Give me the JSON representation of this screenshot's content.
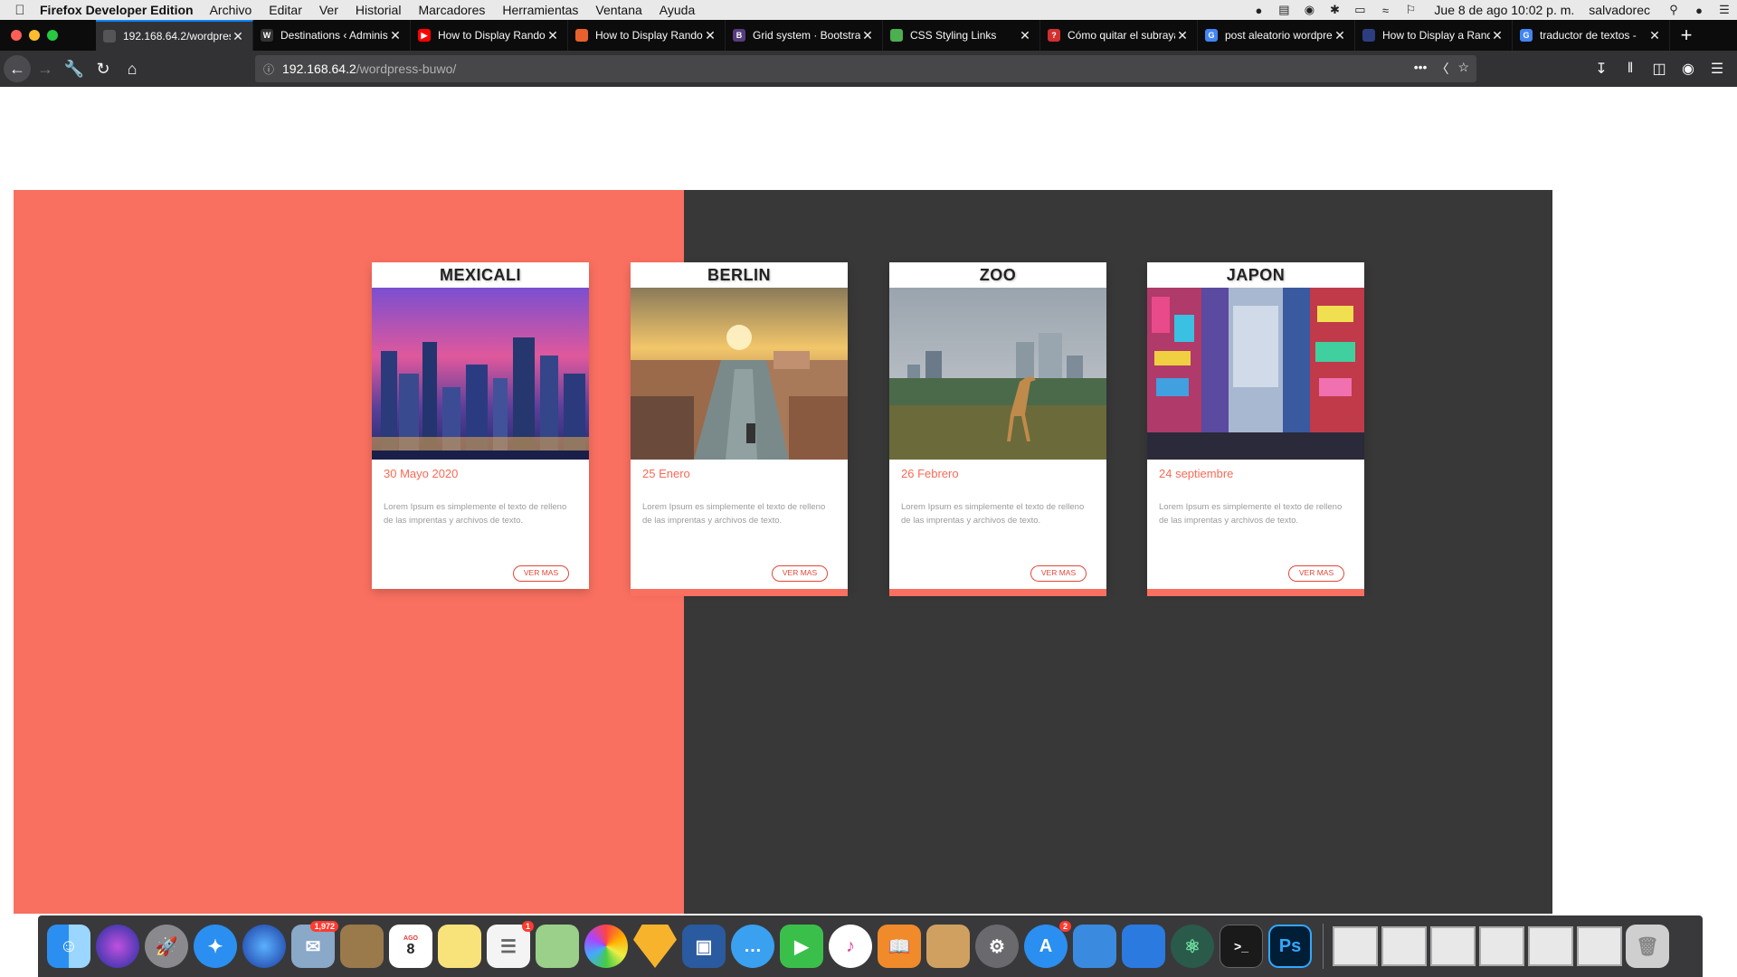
{
  "menubar": {
    "app_name": "Firefox Developer Edition",
    "items": [
      "Archivo",
      "Editar",
      "Ver",
      "Historial",
      "Marcadores",
      "Herramientas",
      "Ventana",
      "Ayuda"
    ],
    "clock": "Jue 8 de ago  10:02 p. m.",
    "user": "salvadorec"
  },
  "tabs": [
    {
      "title": "192.168.64.2/wordpress-b",
      "favicon_color": "#555555"
    },
    {
      "title": "Destinations ‹ Administra",
      "favicon_color": "#333333"
    },
    {
      "title": "How to Display Rando",
      "favicon_color": "#ff0000"
    },
    {
      "title": "How to Display Rando",
      "favicon_color": "#e8612c"
    },
    {
      "title": "Grid system · Bootstra",
      "favicon_color": "#563d7c"
    },
    {
      "title": "CSS Styling Links",
      "favicon_color": "#4caf50"
    },
    {
      "title": "Cómo quitar el subraya",
      "favicon_color": "#d32f2f"
    },
    {
      "title": "post aleatorio wordpre",
      "favicon_color": "#4285f4"
    },
    {
      "title": "How to Display a Rand",
      "favicon_color": "#2c3e80"
    },
    {
      "title": "traductor de textos -",
      "favicon_color": "#4285f4"
    }
  ],
  "url": {
    "host": "192.168.64.2",
    "path": "/wordpress-buwo/"
  },
  "cards": [
    {
      "title": "MEXICALI",
      "date": "30 Mayo 2020",
      "text": "Lorem Ipsum es simplemente el texto de relleno de las imprentas y archivos de texto.",
      "button": "VER MAS"
    },
    {
      "title": "BERLIN",
      "date": "25 Enero",
      "text": "Lorem Ipsum es simplemente el texto de relleno de las imprentas y archivos de texto.",
      "button": "VER MAS"
    },
    {
      "title": "ZOO",
      "date": "26 Febrero",
      "text": "Lorem Ipsum es simplemente el texto de relleno de las imprentas y archivos de texto.",
      "button": "VER MAS"
    },
    {
      "title": "JAPON",
      "date": "24 septiembre",
      "text": "Lorem Ipsum es simplemente el texto de relleno de las imprentas y archivos de texto.",
      "button": "VER MAS"
    }
  ],
  "colors": {
    "coral": "#fa7060",
    "dark": "#383838",
    "accent_red": "#e0483a"
  },
  "dock": {
    "mail_badge": "1,972",
    "reminders_badge": "1",
    "appstore_badge": "2",
    "calendar_month": "AGO",
    "calendar_day": "8"
  }
}
